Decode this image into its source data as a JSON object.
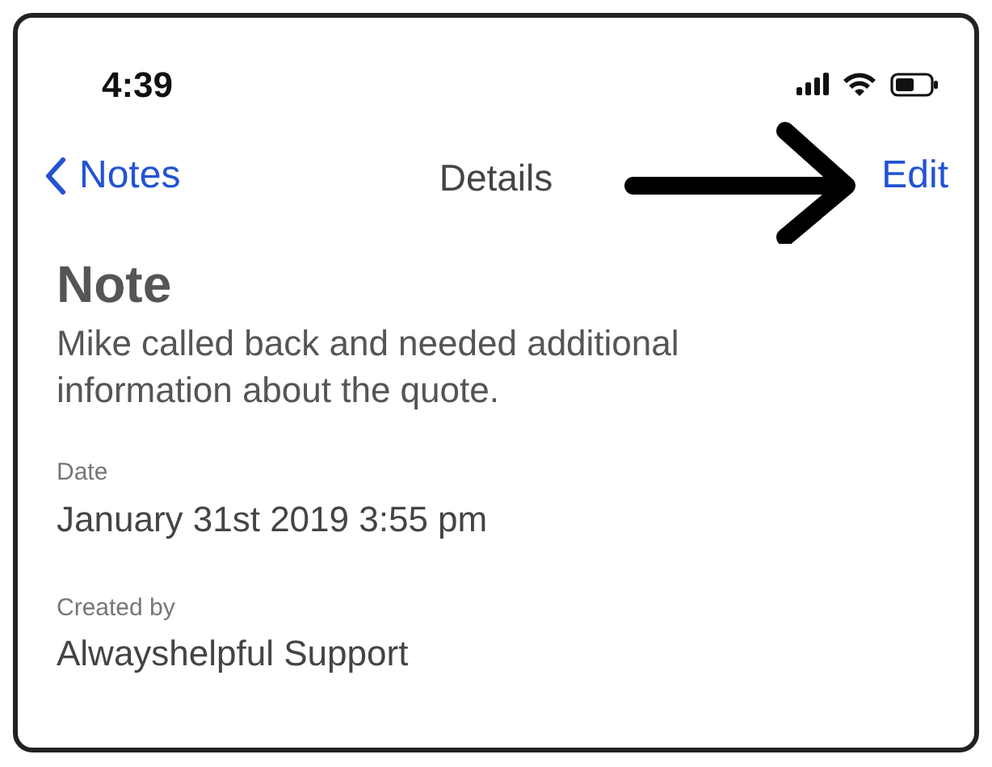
{
  "status_bar": {
    "time": "4:39"
  },
  "nav": {
    "back": "Notes",
    "title": "Details",
    "action": "Edit"
  },
  "note": {
    "heading": "Note",
    "body": "Mike called back and needed additional information about the quote."
  },
  "fields": [
    {
      "label": "Date",
      "value": "January 31st 2019 3:55 pm"
    },
    {
      "label": "Created by",
      "value": "Alwayshelpful Support"
    }
  ]
}
